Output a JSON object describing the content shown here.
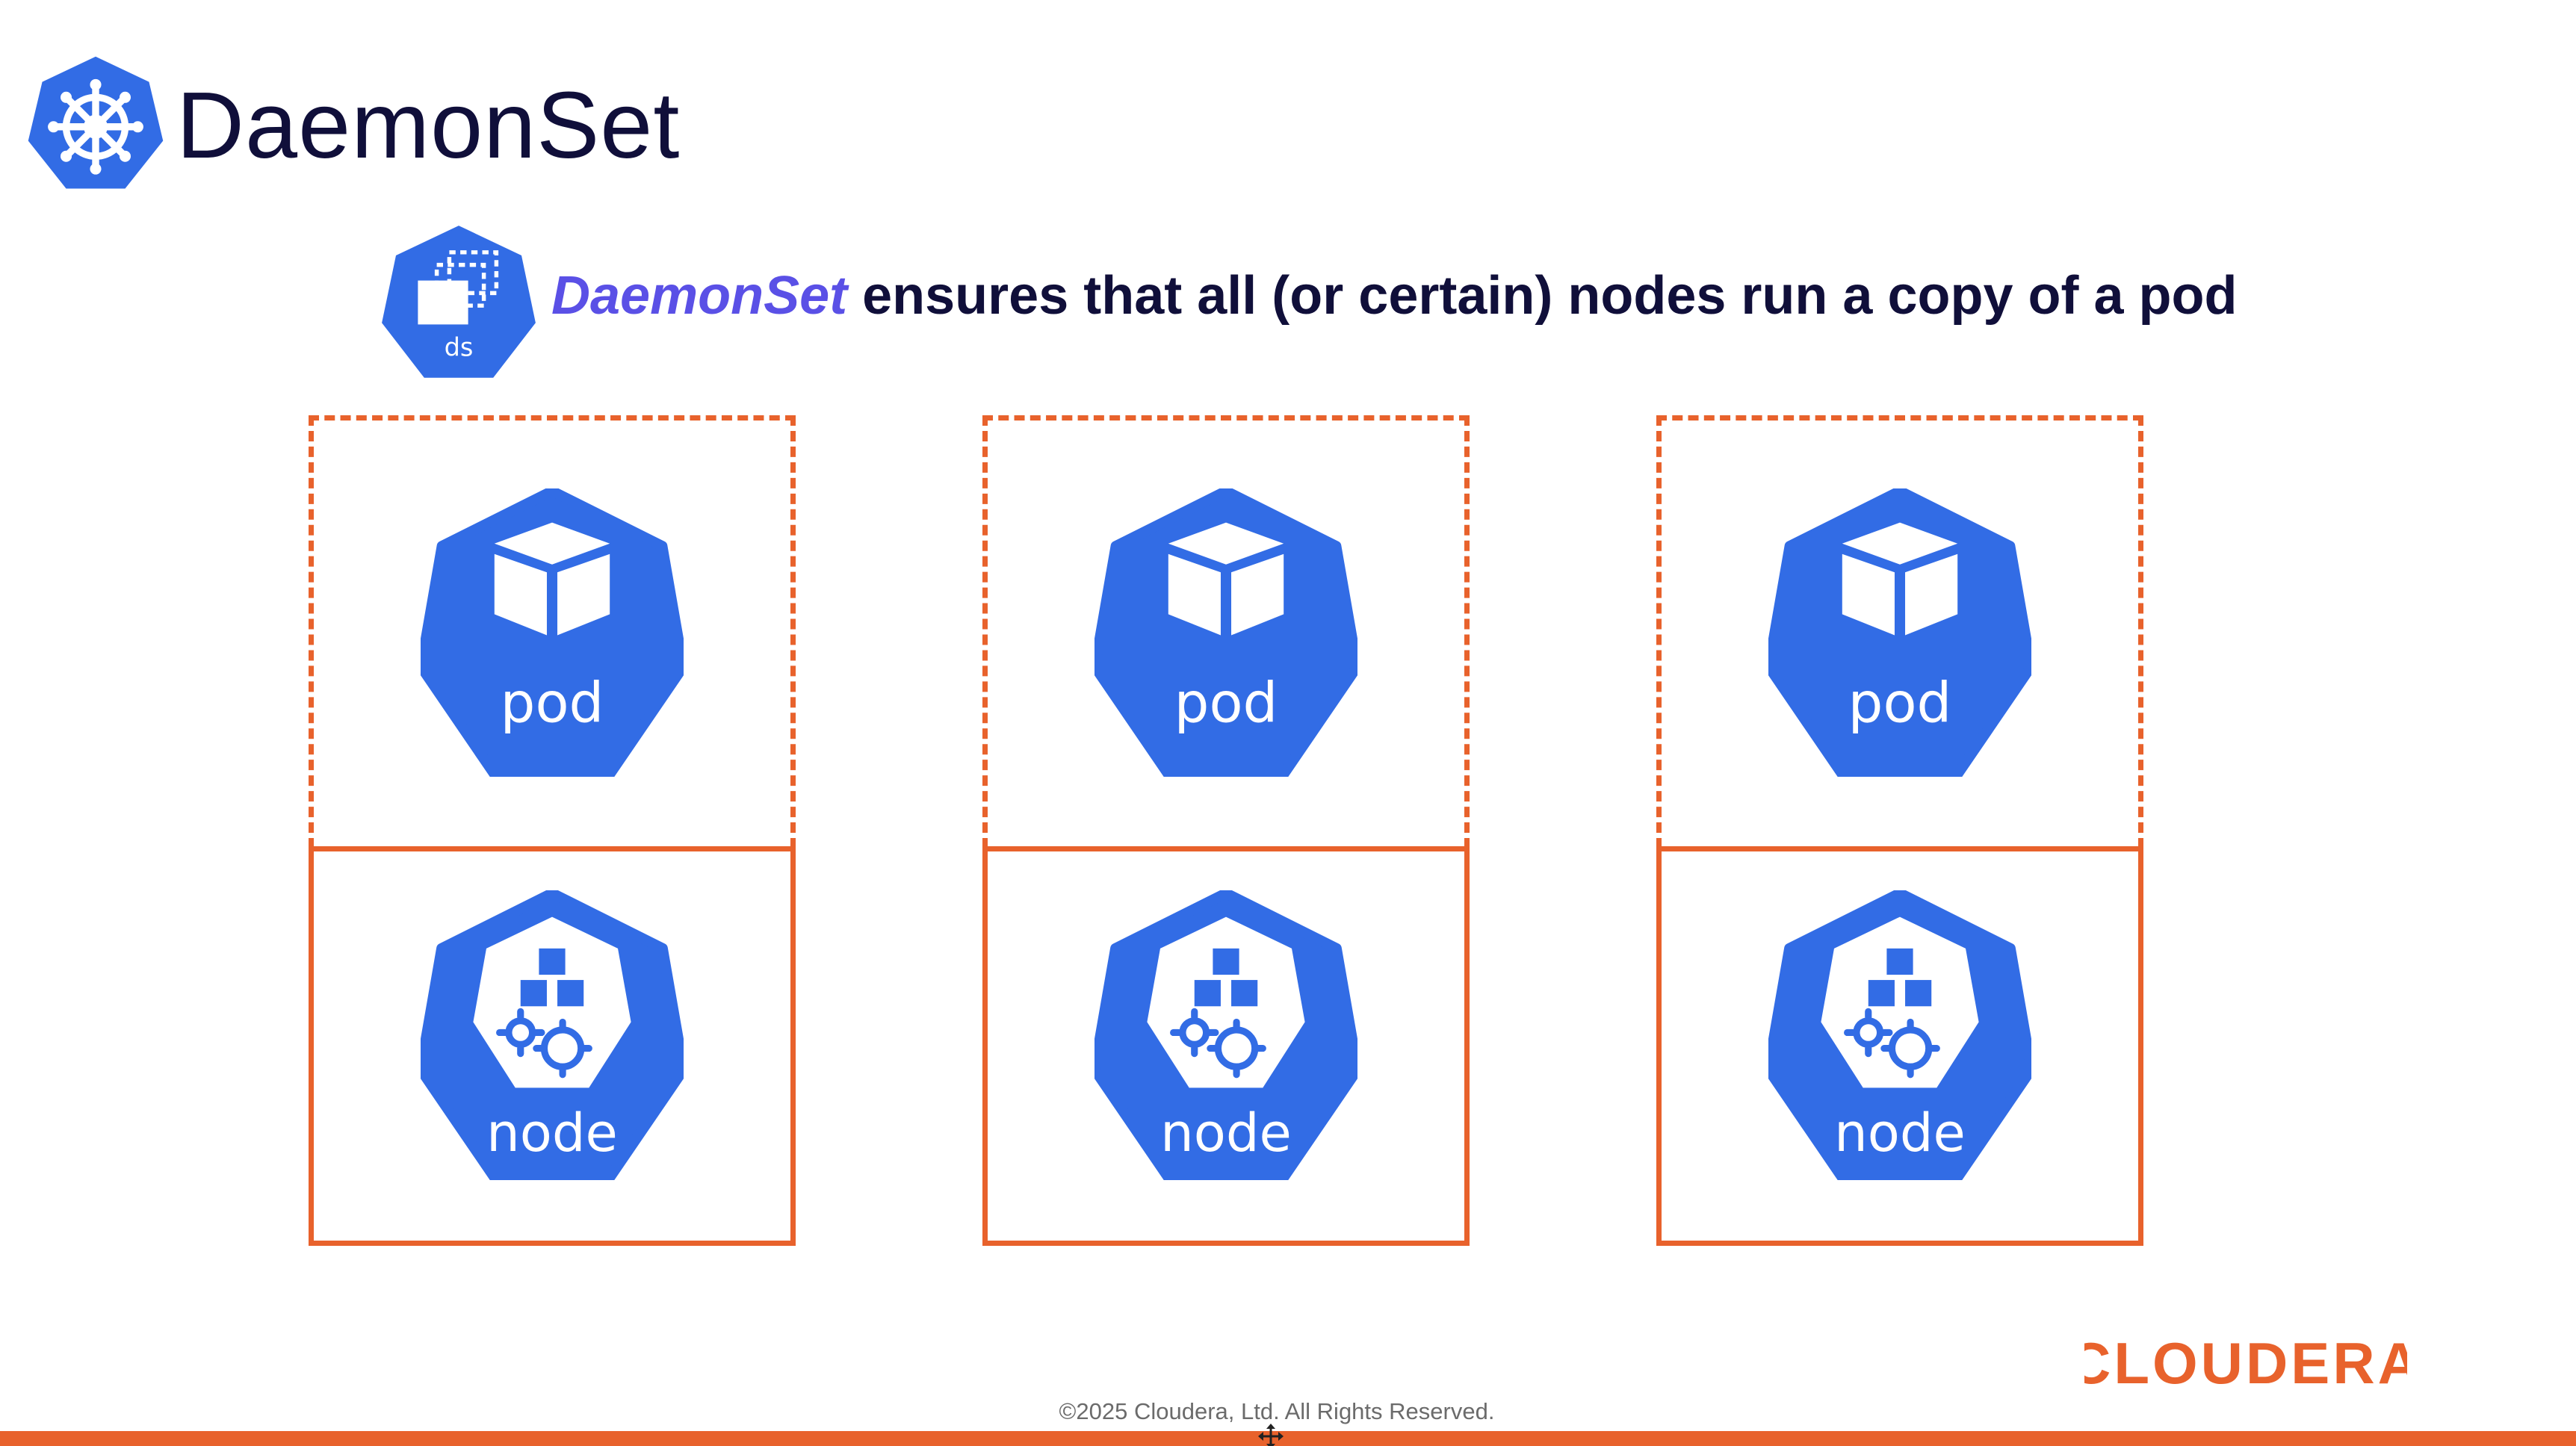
{
  "header": {
    "title": "DaemonSet",
    "logo_icon": "kubernetes-helm-wheel-icon"
  },
  "subtitle": {
    "icon": "daemonset-ds-icon",
    "icon_label": "ds",
    "term": "DaemonSet",
    "text": " ensures that all (or certain) nodes run a copy of a pod"
  },
  "columns": [
    {
      "pod_label": "pod",
      "node_label": "node"
    },
    {
      "pod_label": "pod",
      "node_label": "node"
    },
    {
      "pod_label": "pod",
      "node_label": "node"
    }
  ],
  "footer": {
    "brand": "CLOUDERA",
    "copyright": "©2025 Cloudera, Ltd. All Rights Reserved."
  },
  "colors": {
    "k8s_blue": "#326ce5",
    "accent_orange": "#e8622c",
    "title_navy": "#100f3a",
    "term_purple": "#5a50e6"
  }
}
